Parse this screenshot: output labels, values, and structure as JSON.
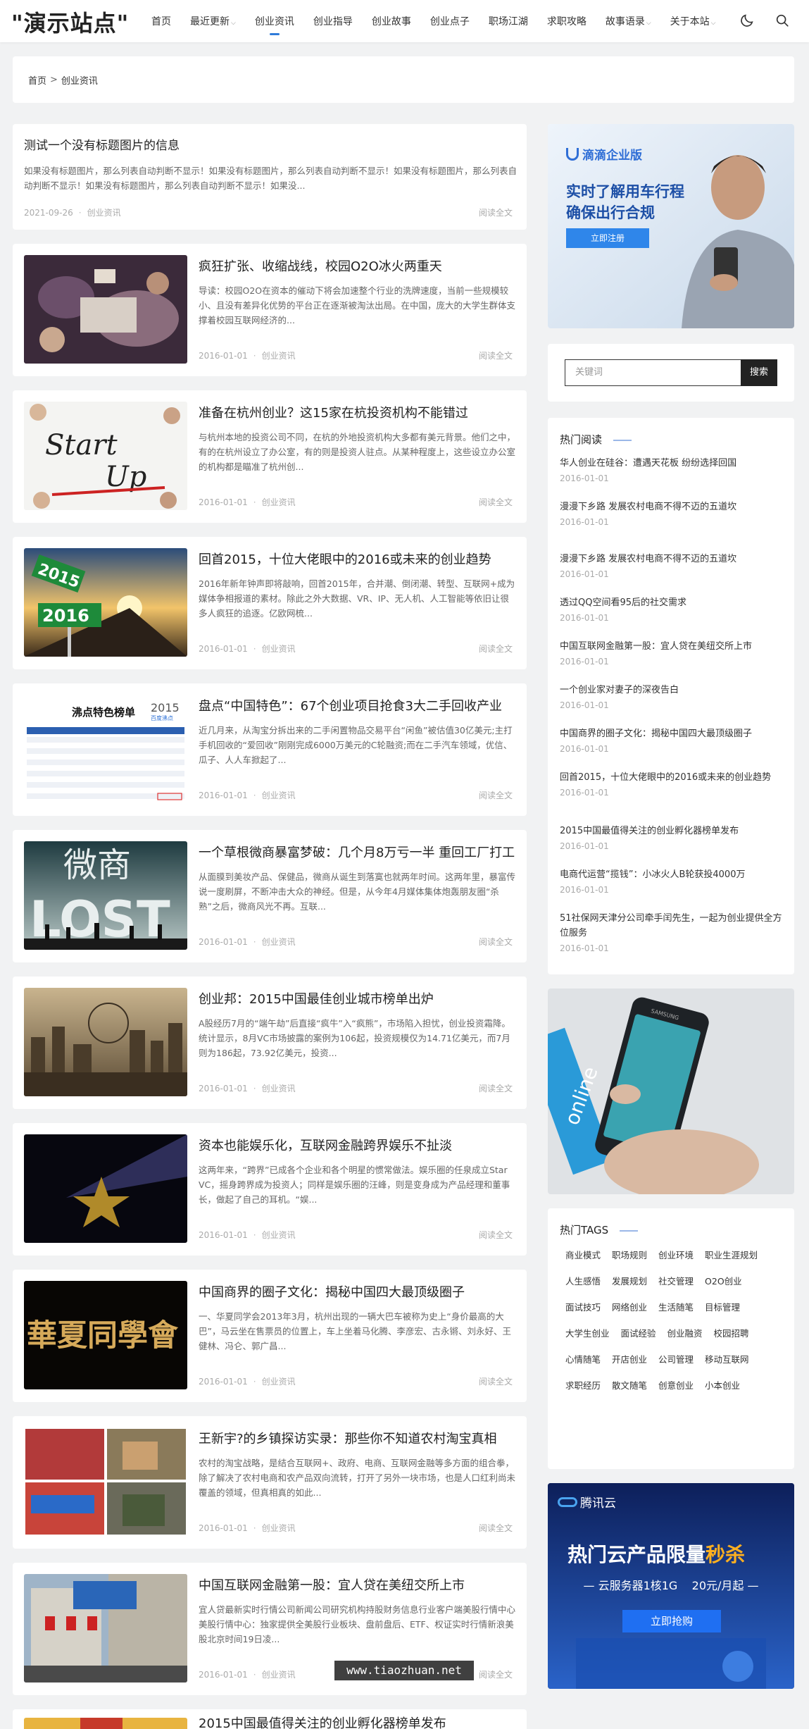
{
  "header": {
    "logo": "\"演示站点\"",
    "nav": [
      {
        "label": "首页",
        "has_caret": false,
        "active": false
      },
      {
        "label": "最近更新",
        "has_caret": true,
        "active": false
      },
      {
        "label": "创业资讯",
        "has_caret": false,
        "active": true
      },
      {
        "label": "创业指导",
        "has_caret": false,
        "active": false
      },
      {
        "label": "创业故事",
        "has_caret": false,
        "active": false
      },
      {
        "label": "创业点子",
        "has_caret": false,
        "active": false
      },
      {
        "label": "职场江湖",
        "has_caret": false,
        "active": false
      },
      {
        "label": "求职攻略",
        "has_caret": false,
        "active": false
      },
      {
        "label": "故事语录",
        "has_caret": true,
        "active": false
      },
      {
        "label": "关于本站",
        "has_caret": true,
        "active": false
      }
    ],
    "icons": [
      "moon-icon",
      "search-icon"
    ],
    "accent_color": "#2f7bd9"
  },
  "breadcrumb": {
    "home": "首页",
    "sep": ">",
    "current": "创业资讯"
  },
  "articles": [
    {
      "title": "测试一个没有标题图片的信息",
      "excerpt": "如果没有标题图片，那么列表自动判断不显示！如果没有标题图片，那么列表自动判断不显示！如果没有标题图片，那么列表自动判断不显示！如果没有标题图片，那么列表自动判断不显示！如果没...",
      "date": "2021-09-26",
      "category": "创业资讯",
      "more": "阅读全文",
      "has_thumb": false
    },
    {
      "title": "疯狂扩张、收缩战线，校园O2O冰火两重天",
      "excerpt": "导读：校园O2O在资本的催动下将会加速整个行业的洗牌速度，当前一些规模较小、且没有差异化优势的平台正在逐渐被淘汰出局。在中国，庞大的大学生群体支撑着校园互联网经济的...",
      "date": "2016-01-01",
      "category": "创业资讯",
      "more": "阅读全文",
      "has_thumb": true,
      "thumb": "people-meeting"
    },
    {
      "title": "准备在杭州创业？这15家在杭投资机构不能错过",
      "excerpt": "与杭州本地的投资公司不同，在杭的外地投资机构大多都有美元背景。他们之中，有的在杭州设立了办公室，有的则是投资人驻点。从某种程度上，这些设立办公室的机构都是瞄准了杭州创...",
      "date": "2016-01-01",
      "category": "创业资讯",
      "more": "阅读全文",
      "has_thumb": true,
      "thumb": "start-up",
      "thumb_text": [
        "Start",
        "Up"
      ]
    },
    {
      "title": "回首2015，十位大佬眼中的2016或未来的创业趋势",
      "excerpt": "2016年新年钟声即将敲响，回首2015年，合并潮、倒闭潮、转型、互联网+成为媒体争相报道的素材。除此之外大数据、VR、IP、无人机、人工智能等依旧让很多人疯狂的追逐。亿欧网梳...",
      "date": "2016-01-01",
      "category": "创业资讯",
      "more": "阅读全文",
      "has_thumb": true,
      "thumb": "road-sign",
      "thumb_text": [
        "2015",
        "2016"
      ]
    },
    {
      "title": "盘点“中国特色”：67个创业项目抢食3大二手回收产业",
      "excerpt": "近几月来，从淘宝分拆出来的二手闲置物品交易平台“闲鱼”被估值30亿美元;主打手机回收的“爱回收”刚刚完成6000万美元的C轮融资;而在二手汽车领域，优信、瓜子、人人车掀起了...",
      "date": "2016-01-01",
      "category": "创业资讯",
      "more": "阅读全文",
      "has_thumb": true,
      "thumb": "table-chart",
      "thumb_text": [
        "沸点特色榜单",
        "2015",
        "百度沸点"
      ]
    },
    {
      "title": "一个草根微商暴富梦破：几个月8万亏一半 重回工厂打工",
      "excerpt": "从面膜到美妆产品、保健品，微商从诞生到落寞也就两年时间。这两年里，暴富传说一度刷屏，不断冲击大众的神经。但是，从今年4月媒体集体炮轰朋友圈“杀熟”之后，微商风光不再。互联...",
      "date": "2016-01-01",
      "category": "创业资讯",
      "more": "阅读全文",
      "has_thumb": true,
      "thumb": "weishang-lost",
      "thumb_text": [
        "微商",
        "LOST"
      ]
    },
    {
      "title": "创业邦：2015中国最佳创业城市榜单出炉",
      "excerpt": "A股经历7月的“端午劫”后直接“疯牛”入“疯熊”，市场陷入担忧，创业投资霜降。统计显示，8月VC市场披露的案例为106起，投资规模仅为14.71亿美元，而7月则为186起，73.92亿美元，投资...",
      "date": "2016-01-01",
      "category": "创业资讯",
      "more": "阅读全文",
      "has_thumb": true,
      "thumb": "city"
    },
    {
      "title": "资本也能娱乐化，互联网金融跨界娱乐不扯淡",
      "excerpt": "这两年来，“跨界”已成各个企业和各个明星的惯常做法。娱乐圈的任泉成立Star VC，摇身跨界成为投资人；同样是娱乐圈的汪峰，则是变身成为产品经理和董事长，做起了自己的耳机。“娱...",
      "date": "2016-01-01",
      "category": "创业资讯",
      "more": "阅读全文",
      "has_thumb": true,
      "thumb": "star"
    },
    {
      "title": "中国商界的圈子文化：揭秘中国四大最顶级圈子",
      "excerpt": "一、华夏同学会2013年3月，杭州出现的一辆大巴车被称为史上“身价最高的大巴”，马云坐在售票员的位置上，车上坐着马化腾、李彦宏、古永锵、刘永好、王健林、冯仑、郭广昌...",
      "date": "2016-01-01",
      "category": "创业资讯",
      "more": "阅读全文",
      "has_thumb": true,
      "thumb": "calligraphy",
      "thumb_text": [
        "華夏同學會"
      ]
    },
    {
      "title": "王新宇?的乡镇探访实录：那些你不知道农村淘宝真相",
      "excerpt": "农村的淘宝战略，是结合互联网+、政府、电商、互联网金融等多方面的组合拳，除了解决了农村电商和农产品双向流转，打开了另外一块市场，也是人口红利尚未覆盖的领域，但真相真的如此...",
      "date": "2016-01-01",
      "category": "创业资讯",
      "more": "阅读全文",
      "has_thumb": true,
      "thumb": "collage"
    },
    {
      "title": "中国互联网金融第一股：宜人贷在美纽交所上市",
      "excerpt": "宜人贷最新实时行情公司新闻公司研究机构持股财务信息行业客户端美股行情中心 美股行情中心：独家提供全美股行业板块、盘前盘后、ETF、权证实时行情新浪美股北京时间19日凌...",
      "date": "2016-01-01",
      "category": "创业资讯",
      "more": "阅读全文",
      "has_thumb": true,
      "thumb": "nyse"
    },
    {
      "title": "2015中国最值得关注的创业孵化器榜单发布",
      "excerpt": "",
      "date": "",
      "category": "",
      "more": "",
      "has_thumb": true,
      "thumb": "partial"
    }
  ],
  "watermark": "www.tiaozhuan.net",
  "sidebar": {
    "ad1": {
      "brand": "滴滴企业版",
      "headline_1": "实时了解用车行程",
      "headline_2": "确保出行合规",
      "button": "立即注册"
    },
    "search": {
      "placeholder": "关键词",
      "button": "搜索"
    },
    "hot": {
      "title": "热门阅读",
      "items": [
        {
          "title": "华人创业在硅谷：遭遇天花板 纷纷选择回国",
          "date": "2016-01-01"
        },
        {
          "title": "漫漫下乡路 发展农村电商不得不迈的五道坎",
          "date": "2016-01-01"
        },
        {
          "title": "漫漫下乡路 发展农村电商不得不迈的五道坎",
          "date": "2016-01-01"
        },
        {
          "title": "透过QQ空间看95后的社交需求",
          "date": "2016-01-01"
        },
        {
          "title": "中国互联网金融第一股：宜人贷在美纽交所上市",
          "date": "2016-01-01"
        },
        {
          "title": "一个创业家对妻子的深夜告白",
          "date": "2016-01-01"
        },
        {
          "title": "中国商界的圈子文化：揭秘中国四大最顶级圈子",
          "date": "2016-01-01"
        },
        {
          "title": "回首2015，十位大佬眼中的2016或未来的创业趋势",
          "date": "2016-01-01"
        },
        {
          "title": "2015中国最值得关注的创业孵化器榜单发布",
          "date": "2016-01-01"
        },
        {
          "title": "电商代运营“揽钱”：小冰火人B轮获投4000万",
          "date": "2016-01-01"
        },
        {
          "title": "51社保网天津分公司牵手闰先生，一起为创业提供全方位服务",
          "date": "2016-01-01"
        }
      ]
    },
    "ad2": {
      "phone_text": "SAMSUNG",
      "bg_text": "online"
    },
    "tags": {
      "title": "热门TAGS",
      "items": [
        "商业模式",
        "职场规则",
        "创业环境",
        "职业生涯规划",
        "人生感悟",
        "发展规划",
        "社交管理",
        "O2O创业",
        "面试技巧",
        "网络创业",
        "生活随笔",
        "目标管理",
        "大学生创业",
        "面试经验",
        "创业融资",
        "校园招聘",
        "心情随笔",
        "开店创业",
        "公司管理",
        "移动互联网",
        "求职经历",
        "散文随笔",
        "创意创业",
        "小本创业"
      ]
    },
    "ad3": {
      "brand": "腾讯云",
      "headline_1": "热门云产品限量",
      "headline_hl": "秒杀",
      "sub": "— 云服务器1核1G    20元/月起 —",
      "button": "立即抢购"
    }
  }
}
